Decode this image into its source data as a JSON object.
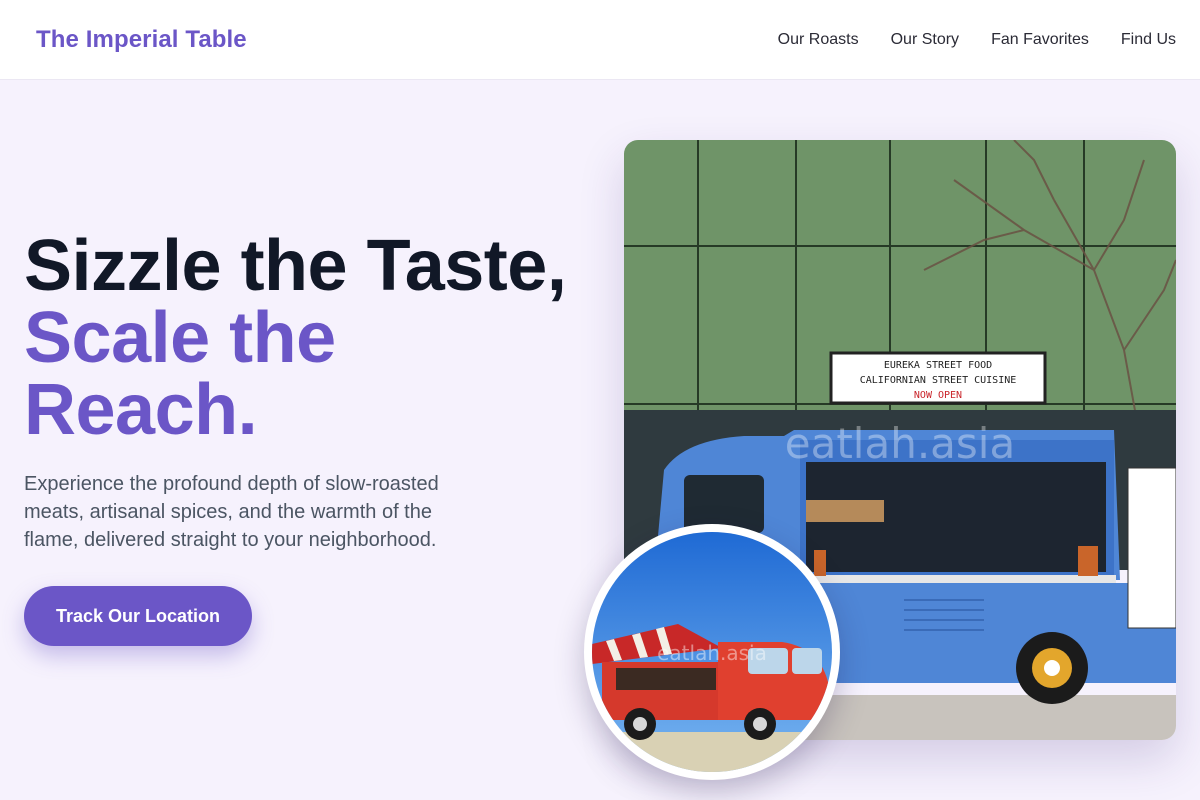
{
  "brand": {
    "name": "The Imperial Table"
  },
  "nav": {
    "items": [
      {
        "label": "Our Roasts"
      },
      {
        "label": "Our Story"
      },
      {
        "label": "Fan Favorites"
      },
      {
        "label": "Find Us"
      }
    ]
  },
  "hero": {
    "headline_line1": "Sizzle the Taste,",
    "headline_line2": "Scale the",
    "headline_line3": "Reach.",
    "description": "Experience the profound depth of slow-roasted meats, artisanal spices, and the warmth of the flame, delivered straight to your neighborhood.",
    "cta_label": "Track Our Location"
  },
  "photo_main": {
    "sign_line1": "EUREKA STREET FOOD",
    "sign_line2": "CALIFORNIAN STREET CUISINE",
    "sign_line3": "NOW OPEN",
    "watermark": "eatlah.asia"
  },
  "photo_inset": {
    "watermark": "eatlah.asia"
  },
  "colors": {
    "accent": "#6b56c7",
    "background": "#f6f2fd",
    "headline_dark": "#111827"
  }
}
